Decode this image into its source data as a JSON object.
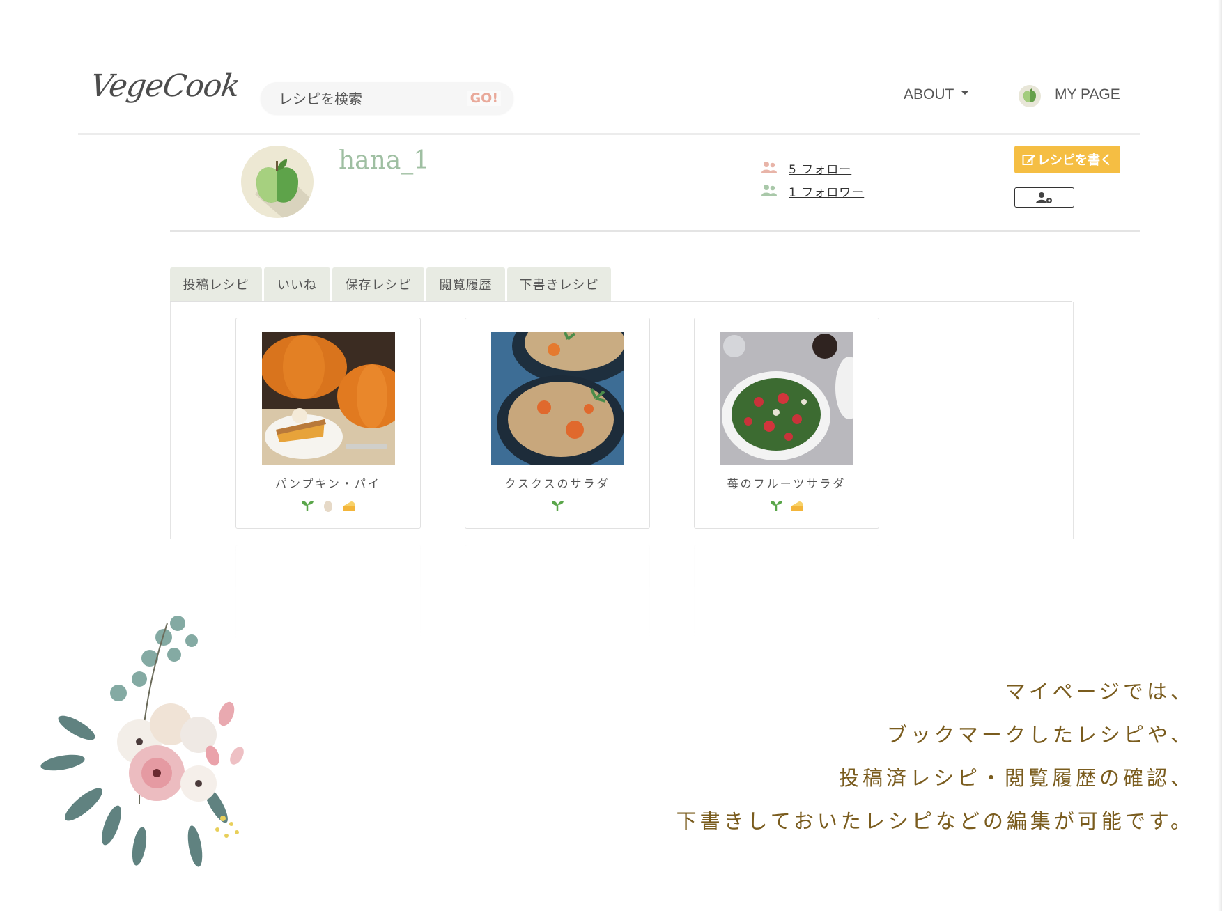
{
  "nav": {
    "logo": "VegeCook",
    "search_placeholder": "レシピを検索",
    "search_button": "GO!",
    "about": "ABOUT",
    "my_page": "MY PAGE"
  },
  "profile": {
    "username": "hana_1",
    "follow": "5 フォロー",
    "follower": "1 フォロワー",
    "write_button": "レシピを書く"
  },
  "tabs": [
    {
      "label": "投稿レシピ"
    },
    {
      "label": "いいね"
    },
    {
      "label": "保存レシピ"
    },
    {
      "label": "閲覧履歴"
    },
    {
      "label": "下書きレシピ"
    }
  ],
  "recipes": [
    {
      "title": "パンプキン・パイ",
      "tags": [
        "sprout-icon",
        "egg-icon",
        "cheese-icon"
      ]
    },
    {
      "title": "クスクスのサラダ",
      "tags": [
        "sprout-icon"
      ]
    },
    {
      "title": "苺のフルーツサラダ",
      "tags": [
        "sprout-icon",
        "cheese-icon"
      ]
    }
  ],
  "caption": [
    "マイページでは、",
    "ブックマークしたレシピや、",
    "投稿済レシピ・閲覧履歴の確認、",
    "下書きしておいたレシピなどの編集が可能です。"
  ],
  "colors": {
    "accent_yellow": "#f5be43",
    "username_green": "#9fbfa2",
    "caption_brown": "#7a5c1e",
    "tab_bg": "#e8ebe3"
  }
}
